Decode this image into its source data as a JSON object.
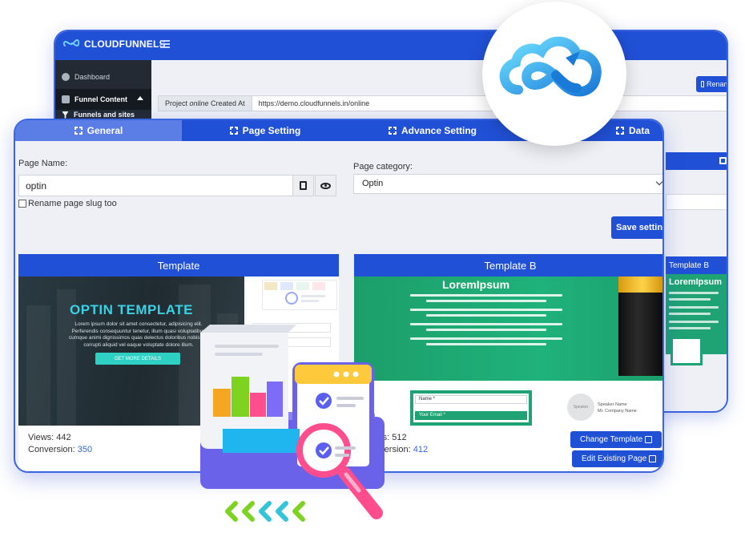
{
  "app": {
    "brand": "CLOUDFUNNELS"
  },
  "sidebar": {
    "items": [
      {
        "label": "Dashboard",
        "icon": "dashboard-icon"
      },
      {
        "label": "Funnel Content",
        "icon": "document-icon"
      },
      {
        "label": "Funnels and sites",
        "icon": "funnel-icon"
      }
    ]
  },
  "project": {
    "label_prefix": "Project ",
    "label_italic": "online",
    "label_suffix": " Created At",
    "url": "https://demo.cloudfunnels.in/online",
    "rename_label": "Renam"
  },
  "tabs": [
    {
      "label": "General",
      "icon": "grid-icon",
      "active": true
    },
    {
      "label": "Page Setting",
      "icon": "grid-icon"
    },
    {
      "label": "Advance Setting",
      "icon": "grid-icon"
    },
    {
      "label": "Data",
      "icon": "grid-icon"
    }
  ],
  "form": {
    "page_name_label": "Page Name:",
    "page_name_value": "optin",
    "rename_slug_label": "Rename page slug too",
    "category_label": "Page category:",
    "category_value": "Optin",
    "save_label": "Save settings"
  },
  "templates": [
    {
      "head": "Template",
      "title": "OPTIN TEMPLATE",
      "body": "Lorem ipsum dolor sit amet consectetur, adipisicing elit. Perferendis consequuntur tenetur, illum quasi voluptatibus cumque animi dignissimos quas delectus doloribus nobis qui corrupti aliquid vel eaque voluptate dolore illum.",
      "cta": "GET MORE DETAILS",
      "field_name": "Name *",
      "views_label": "Views: ",
      "views": "442",
      "conversion_label": "Conversion: ",
      "conversion": "350"
    },
    {
      "head": "Template B",
      "title": "LoremIpsum",
      "field_name": "Name *",
      "field_email": "Your Email *",
      "speaker_name": "Speaker Name",
      "speaker_company": "Mr. Company Name",
      "avatar": "Speaker",
      "views_label": "Views: ",
      "views": "512",
      "conversion_label": "Conversion: ",
      "conversion": "412",
      "change_label": "Change Template",
      "edit_label": "Edit Existing Page"
    }
  ],
  "colors": {
    "primary": "#2050d6",
    "tab_active": "#5b7ee6",
    "sidebar": "#232a34",
    "template_b_green": "#1fa374",
    "optin_accent": "#39d1e4",
    "link_number": "#2f6bd8"
  }
}
